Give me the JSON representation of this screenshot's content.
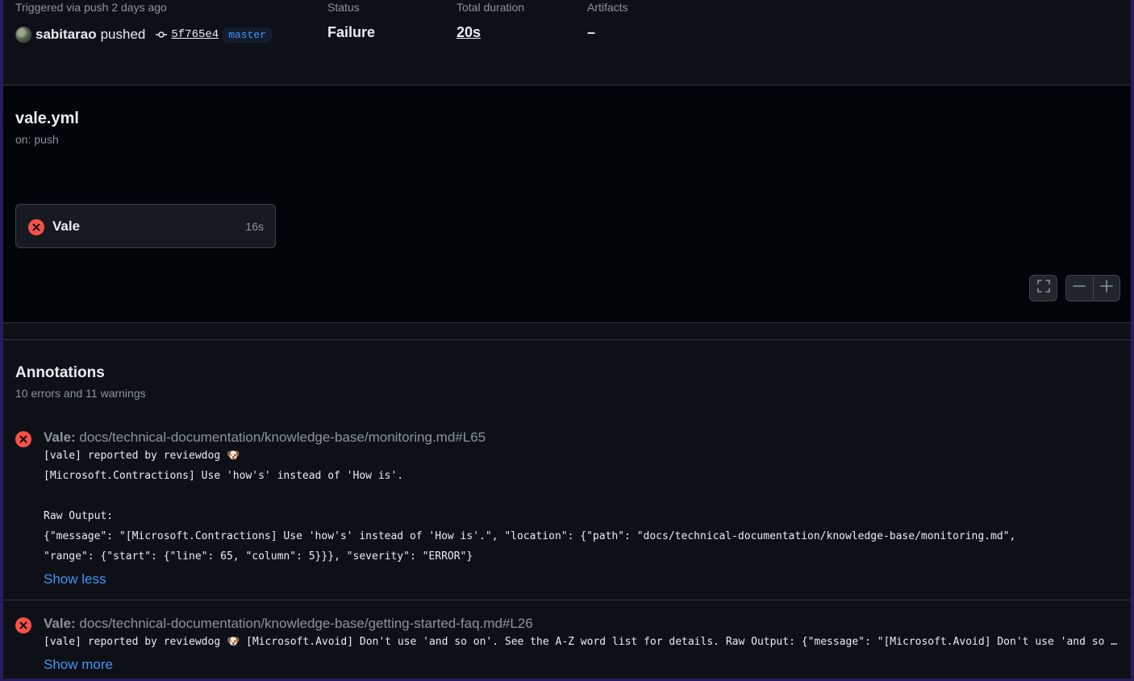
{
  "summary": {
    "trigger_label": "Triggered via push 2 days ago",
    "user": "sabitarao",
    "action": "pushed",
    "commit_sha": "5f765e4",
    "branch": "master",
    "status_label": "Status",
    "status_value": "Failure",
    "duration_label": "Total duration",
    "duration_value": "20s",
    "artifacts_label": "Artifacts",
    "artifacts_value": "–"
  },
  "workflow": {
    "file": "vale.yml",
    "trigger": "on: push",
    "job": {
      "name": "Vale",
      "duration": "16s",
      "status": "failure"
    }
  },
  "annotations": {
    "title": "Annotations",
    "summary": "10 errors and 11 warnings",
    "items": [
      {
        "job": "Vale:",
        "path": " docs/technical-documentation/knowledge-base/monitoring.md#L65",
        "line1": "[vale] reported by reviewdog 🐶",
        "line2": "[Microsoft.Contractions] Use 'how's' instead of 'How is'.",
        "line3": "Raw Output:",
        "line4": "{\"message\": \"[Microsoft.Contractions] Use 'how's' instead of 'How is'.\", \"location\": {\"path\": \"docs/technical-documentation/knowledge-base/monitoring.md\",",
        "line5": "\"range\": {\"start\": {\"line\": 65, \"column\": 5}}}, \"severity\": \"ERROR\"}",
        "toggle": "Show less"
      },
      {
        "job": "Vale:",
        "path": " docs/technical-documentation/knowledge-base/getting-started-faq.md#L26",
        "line1": "[vale] reported by reviewdog 🐶 [Microsoft.Avoid] Don't use 'and so on'. See the A-Z word list for details. Raw Output: {\"message\": \"[Microsoft.Avoid] Don't use 'and so on'. See the A-Z word list for details.\"",
        "toggle": "Show more"
      }
    ]
  },
  "colors": {
    "error": "#f85149",
    "link": "#4493f8",
    "background": "#0d1117",
    "graph_background": "#010409"
  }
}
